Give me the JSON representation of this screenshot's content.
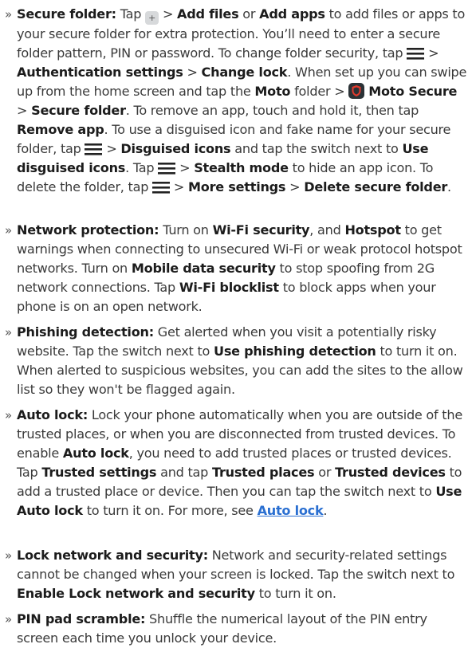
{
  "bullet_glyph": "»",
  "icons": {
    "plus": "+",
    "menu": "menu-icon",
    "moto_secure": "shield-icon",
    "brand_red": "#e23b2e",
    "link_color": "#2a6fd1"
  },
  "secure_folder": {
    "label": "Secure folder:",
    "t1": " Tap ",
    "t2": " > ",
    "add_files": "Add files",
    "t3": " or ",
    "add_apps": "Add apps",
    "t4": " to add files or apps to your secure folder for extra protection. You’ll need to enter a secure folder pattern, PIN or password. To change folder security, tap ",
    "t5": " > ",
    "auth_settings": "Authentication settings",
    "t6": " > ",
    "change_lock": "Change lock",
    "t7": ". When set up you can swipe up from the home screen and tap the ",
    "moto": "Moto",
    "t8": " folder > ",
    "moto_secure": "Moto Secure",
    "t9": " > ",
    "secure_folder_bold": "Secure folder",
    "t10": ". To remove an app, touch and hold it, then tap ",
    "remove_app": "Remove app",
    "t11": ". To use a disguised icon and fake name for your secure folder, tap ",
    "t12": " > ",
    "disguised_icons": "Disguised icons",
    "t13": " and tap the switch next to ",
    "use_disguised": "Use disguised icons",
    "t14": ". Tap ",
    "t15": " > ",
    "stealth_mode": "Stealth mode",
    "t16": " to hide an app icon. To delete the folder, tap ",
    "t17": " > ",
    "more_settings": "More settings",
    "t18": " > ",
    "delete_folder": "Delete secure folder",
    "t19": "."
  },
  "network_protection": {
    "label": "Network protection:",
    "t1": " Turn on ",
    "wifi_security": "Wi-Fi security",
    "t2": ", and ",
    "hotspot": "Hotspot",
    "t3": " to get warnings when connecting to unsecured Wi-Fi or weak protocol hotspot networks. Turn on ",
    "mobile_data": "Mobile data security",
    "t4": " to stop spoofing from 2G network connections. Tap ",
    "wifi_blocklist": "Wi-Fi blocklist",
    "t5": " to block apps when your phone is on an open network."
  },
  "phishing": {
    "label": "Phishing detection:",
    "t1": " Get alerted when you visit a potentially risky website. Tap the switch next to ",
    "use_phishing": "Use phishing detection",
    "t2": " to turn it on. When alerted to suspicious websites, you can add the sites to the allow list so they won't be flagged again."
  },
  "auto_lock": {
    "label": "Auto lock:",
    "t1": " Lock your phone automatically when you are outside of the trusted places, or when you are disconnected from trusted devices. To enable ",
    "auto_lock_bold": "Auto lock",
    "t2": ", you need to add trusted places or trusted devices. Tap ",
    "trusted_settings": "Trusted settings",
    "t3": " and tap ",
    "trusted_places": "Trusted places",
    "t4": " or ",
    "trusted_devices": "Trusted devices",
    "t5": " to add a trusted place or device. Then you can tap the switch next to ",
    "use_auto_lock": "Use Auto lock",
    "t6": " to turn it on. For more, see ",
    "link": "Auto lock",
    "t7": "."
  },
  "lock_network": {
    "label": "Lock network and security:",
    "t1": " Network and security-related settings cannot be changed when your screen is locked. Tap the switch next to ",
    "enable": "Enable Lock network and security",
    "t2": " to turn it on."
  },
  "pin_pad": {
    "label": "PIN pad scramble:",
    "t1": " Shuffle the numerical layout of the PIN entry screen each time you unlock your device."
  }
}
